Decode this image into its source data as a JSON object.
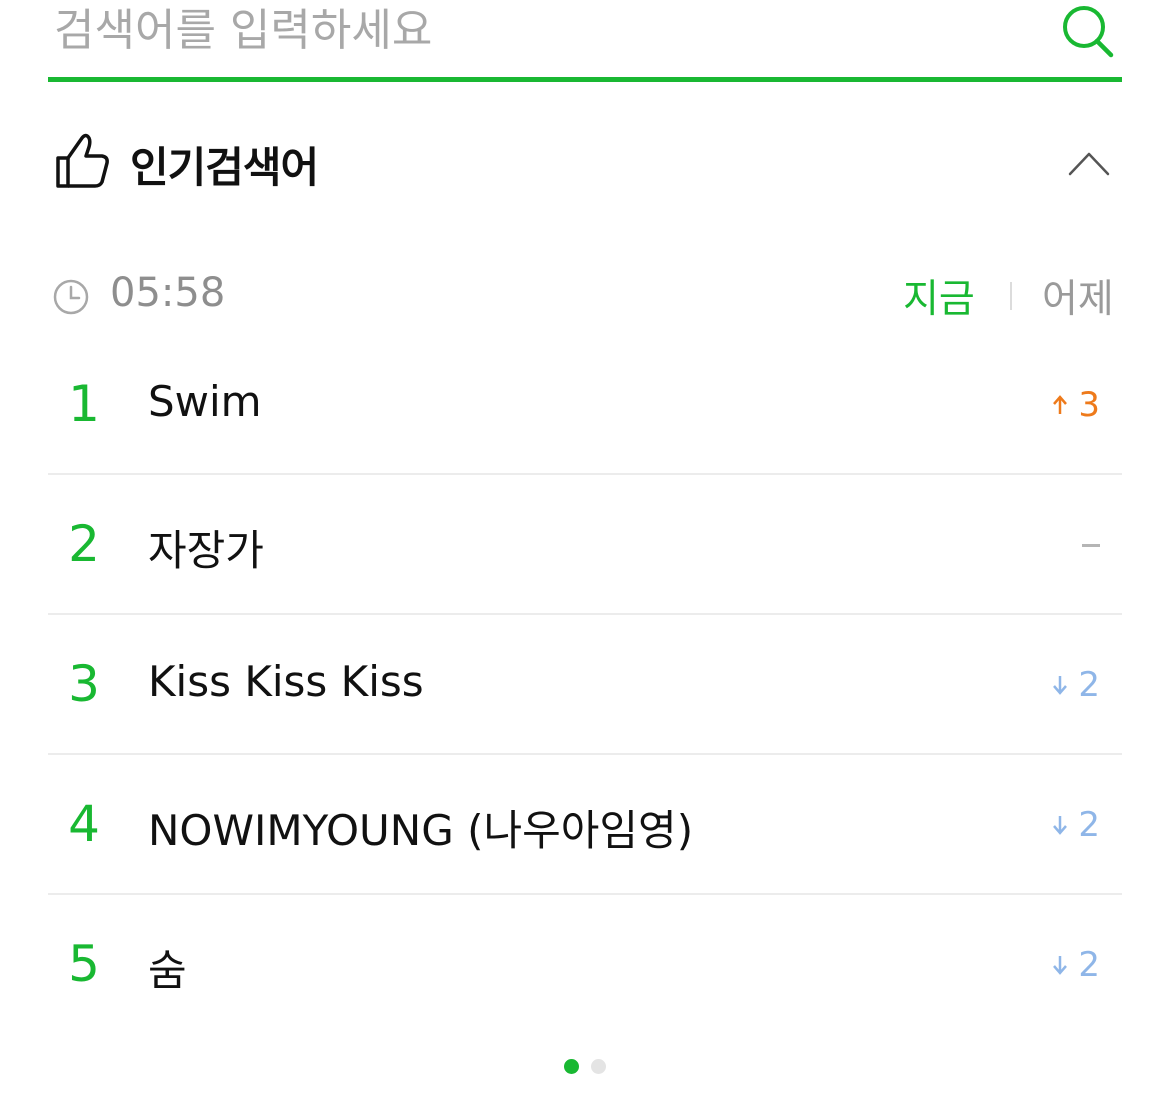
{
  "search": {
    "placeholder": "검색어를 입력하세요",
    "value": ""
  },
  "colors": {
    "accent": "#19b832",
    "up": "#ee7a1b",
    "down": "#8fb6e8",
    "same": "#b5b5b5"
  },
  "popular": {
    "title": "인기검색어",
    "time": "05:58",
    "tabs": {
      "now": "지금",
      "yesterday": "어제",
      "active": "now"
    },
    "items": [
      {
        "rank": "1",
        "keyword": "Swim",
        "change": "3",
        "direction": "up"
      },
      {
        "rank": "2",
        "keyword": "자장가",
        "change": "",
        "direction": "same"
      },
      {
        "rank": "3",
        "keyword": "Kiss Kiss Kiss",
        "change": "2",
        "direction": "down"
      },
      {
        "rank": "4",
        "keyword": "NOWIMYOUNG (나우아임영)",
        "change": "2",
        "direction": "down"
      },
      {
        "rank": "5",
        "keyword": "숨",
        "change": "2",
        "direction": "down"
      }
    ]
  },
  "pager": {
    "current_page": 1,
    "total_pages": 2
  },
  "icons": {
    "search": "search-icon",
    "like": "thumbs-up-icon",
    "collapse": "chevron-up-icon",
    "clock": "clock-icon"
  }
}
